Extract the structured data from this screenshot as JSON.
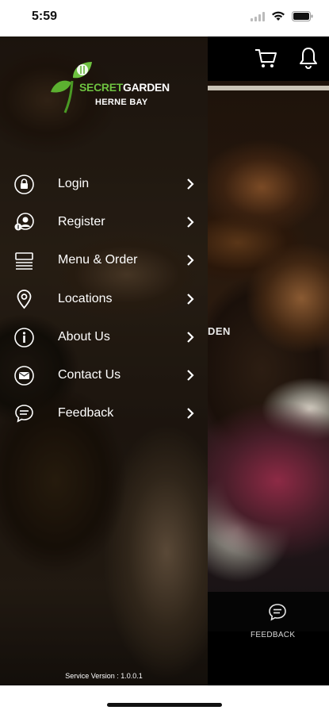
{
  "status_bar": {
    "time": "5:59",
    "icons": [
      "signal-icon",
      "wifi-icon",
      "battery-icon"
    ]
  },
  "header": {
    "icons": [
      "cart-icon",
      "bell-icon"
    ]
  },
  "hero": {
    "caption_fragment": "DEN"
  },
  "tabbar": {
    "feedback_label": "FEEDBACK"
  },
  "drawer": {
    "logo": {
      "name_part1": "SECRET",
      "name_part2": "GARDEN",
      "location": "HERNE BAY",
      "accent_color": "#6ec240"
    },
    "items": [
      {
        "label": "Login",
        "icon": "lock-icon"
      },
      {
        "label": "Register",
        "icon": "register-user-icon"
      },
      {
        "label": "Menu & Order",
        "icon": "menu-list-icon"
      },
      {
        "label": "Locations",
        "icon": "location-pin-icon"
      },
      {
        "label": "About Us",
        "icon": "info-icon"
      },
      {
        "label": "Contact Us",
        "icon": "mail-icon"
      },
      {
        "label": "Feedback",
        "icon": "chat-icon"
      }
    ],
    "service_version": "Service Version : 1.0.0.1"
  },
  "colors": {
    "drawer_text": "#ffffff",
    "top_bar": "#000000",
    "brand_green": "#6ec240"
  }
}
